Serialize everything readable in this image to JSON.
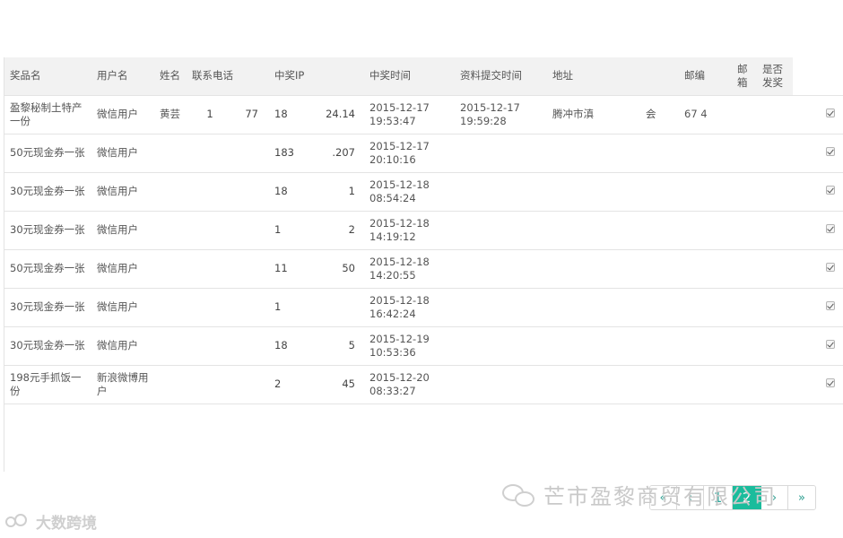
{
  "table": {
    "headers": [
      "奖品名",
      "用户名",
      "姓名",
      "联系电话",
      "中奖IP",
      "中奖时间",
      "资料提交时间",
      "地址",
      "邮编",
      "邮箱",
      "是否发奖"
    ],
    "rows": [
      {
        "prize": "盈黎秘制土特产一份",
        "user": "微信用户",
        "name": "黄芸",
        "phone_a": "1",
        "phone_b": "77",
        "ip_a": "18",
        "ip_b": "24.14",
        "time": "2015-12-17 19:53:47",
        "submit": "2015-12-17 19:59:28",
        "address": "腾冲市滇",
        "address_b": "会",
        "zip": "67  4",
        "email": "",
        "awarded": true
      },
      {
        "prize": "50元现金券一张",
        "user": "微信用户",
        "name": "",
        "phone_a": "",
        "phone_b": "",
        "ip_a": "183",
        "ip_b": ".207",
        "time": "2015-12-17 20:10:16",
        "submit": "",
        "address": "",
        "address_b": "",
        "zip": "",
        "email": "",
        "awarded": true
      },
      {
        "prize": "30元现金券一张",
        "user": "微信用户",
        "name": "",
        "phone_a": "",
        "phone_b": "",
        "ip_a": "18",
        "ip_b": "1",
        "time": "2015-12-18 08:54:24",
        "submit": "",
        "address": "",
        "address_b": "",
        "zip": "",
        "email": "",
        "awarded": true
      },
      {
        "prize": "30元现金券一张",
        "user": "微信用户",
        "name": "",
        "phone_a": "",
        "phone_b": "",
        "ip_a": "1",
        "ip_b": "2",
        "time": "2015-12-18 14:19:12",
        "submit": "",
        "address": "",
        "address_b": "",
        "zip": "",
        "email": "",
        "awarded": true
      },
      {
        "prize": "50元现金券一张",
        "user": "微信用户",
        "name": "",
        "phone_a": "",
        "phone_b": "",
        "ip_a": "11",
        "ip_b": "50",
        "time": "2015-12-18 14:20:55",
        "submit": "",
        "address": "",
        "address_b": "",
        "zip": "",
        "email": "",
        "awarded": true
      },
      {
        "prize": "30元现金券一张",
        "user": "微信用户",
        "name": "",
        "phone_a": "",
        "phone_b": "",
        "ip_a": "1",
        "ip_b": "",
        "time": "2015-12-18 16:42:24",
        "submit": "",
        "address": "",
        "address_b": "",
        "zip": "",
        "email": "",
        "awarded": true
      },
      {
        "prize": "30元现金券一张",
        "user": "微信用户",
        "name": "",
        "phone_a": "",
        "phone_b": "",
        "ip_a": "18",
        "ip_b": "5",
        "time": "2015-12-19 10:53:36",
        "submit": "",
        "address": "",
        "address_b": "",
        "zip": "",
        "email": "",
        "awarded": true
      },
      {
        "prize": "198元手抓饭一份",
        "user": "新浪微博用户",
        "name": "",
        "phone_a": "",
        "phone_b": "",
        "ip_a": "2",
        "ip_b": "45",
        "time": "2015-12-20 08:33:27",
        "submit": "",
        "address": "",
        "address_b": "",
        "zip": "",
        "email": "",
        "awarded": true
      }
    ]
  },
  "pagination": {
    "first": "«",
    "prev": "‹",
    "pages": [
      "1",
      "2"
    ],
    "current": "2",
    "next": "›",
    "last": "»"
  },
  "watermark": {
    "company": "芒市盈黎商贸有限公司",
    "logo_text": "大数跨境",
    "wechat_icon": "wechat-icon",
    "logo_icon": "brand-logo-icon"
  },
  "colors": {
    "accent": "#1abc9c",
    "header_bg": "#f2f2f2",
    "border": "#e4e4e4"
  }
}
